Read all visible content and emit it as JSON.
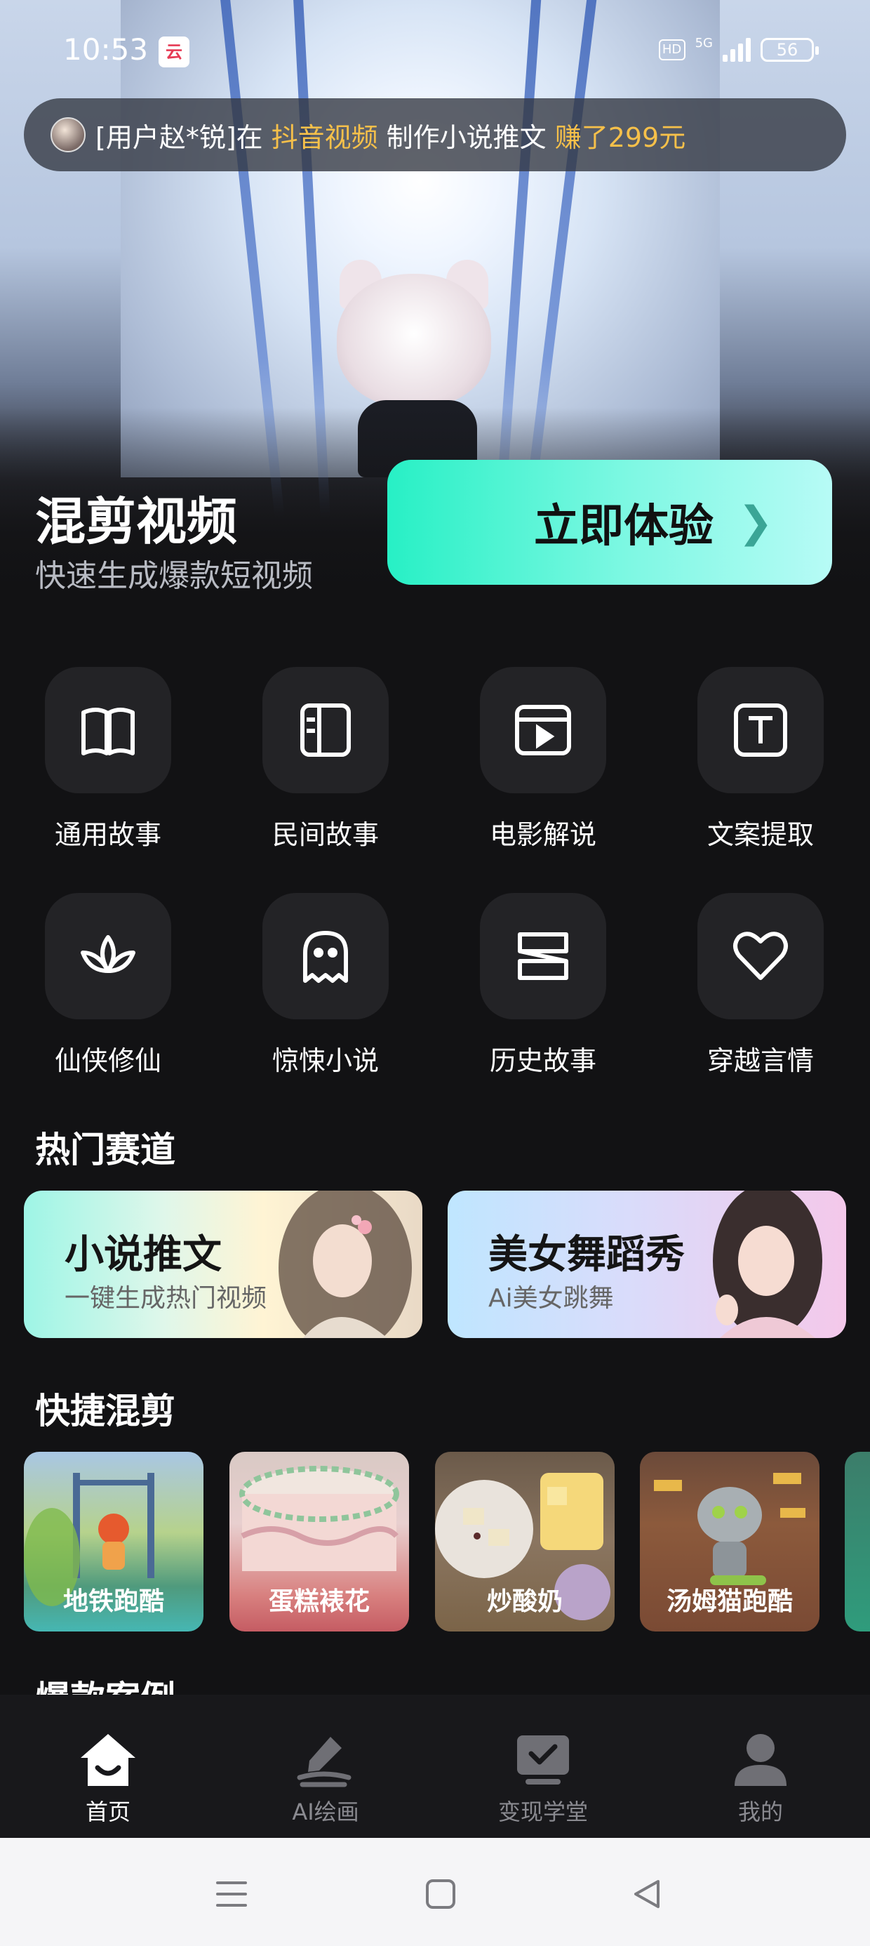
{
  "status": {
    "time": "10:53",
    "app_badge": "云",
    "hd": "HD",
    "network": "5G",
    "battery": "56"
  },
  "ticker": {
    "prefix": "[用户赵*锐]在",
    "platform": "抖音视频",
    "middle": "制作小说推文",
    "earning": "赚了299元"
  },
  "hero": {
    "title": "混剪视频",
    "subtitle": "快速生成爆款短视频",
    "cta": "立即体验",
    "cta_arrow": "❯"
  },
  "categories": [
    {
      "label": "通用故事",
      "icon": "book-open-icon"
    },
    {
      "label": "民间故事",
      "icon": "sidebar-layout-icon"
    },
    {
      "label": "电影解说",
      "icon": "video-play-icon"
    },
    {
      "label": "文案提取",
      "icon": "text-t-icon"
    },
    {
      "label": "仙侠修仙",
      "icon": "lotus-icon"
    },
    {
      "label": "惊悚小说",
      "icon": "ghost-icon"
    },
    {
      "label": "历史故事",
      "icon": "scroll-icon"
    },
    {
      "label": "穿越言情",
      "icon": "heart-icon"
    }
  ],
  "hot_tracks": {
    "title": "热门赛道",
    "cards": [
      {
        "title": "小说推文",
        "subtitle": "一键生成热门视频"
      },
      {
        "title": "美女舞蹈秀",
        "subtitle": "Ai美女跳舞"
      }
    ]
  },
  "quick_cut": {
    "title": "快捷混剪",
    "items": [
      {
        "label": "地铁跑酷"
      },
      {
        "label": "蛋糕裱花"
      },
      {
        "label": "炒酸奶"
      },
      {
        "label": "汤姆猫跑酷"
      }
    ]
  },
  "cases": {
    "title": "爆款案例"
  },
  "tabs": [
    {
      "label": "首页",
      "icon": "home-icon",
      "active": true
    },
    {
      "label": "AI绘画",
      "icon": "pen-brush-icon"
    },
    {
      "label": "变现学堂",
      "icon": "monitor-check-icon"
    },
    {
      "label": "我的",
      "icon": "user-icon"
    }
  ],
  "colors": {
    "accent": "#27f0c5",
    "highlight": "#f6c04a",
    "background": "#121214",
    "tile": "#232326"
  }
}
